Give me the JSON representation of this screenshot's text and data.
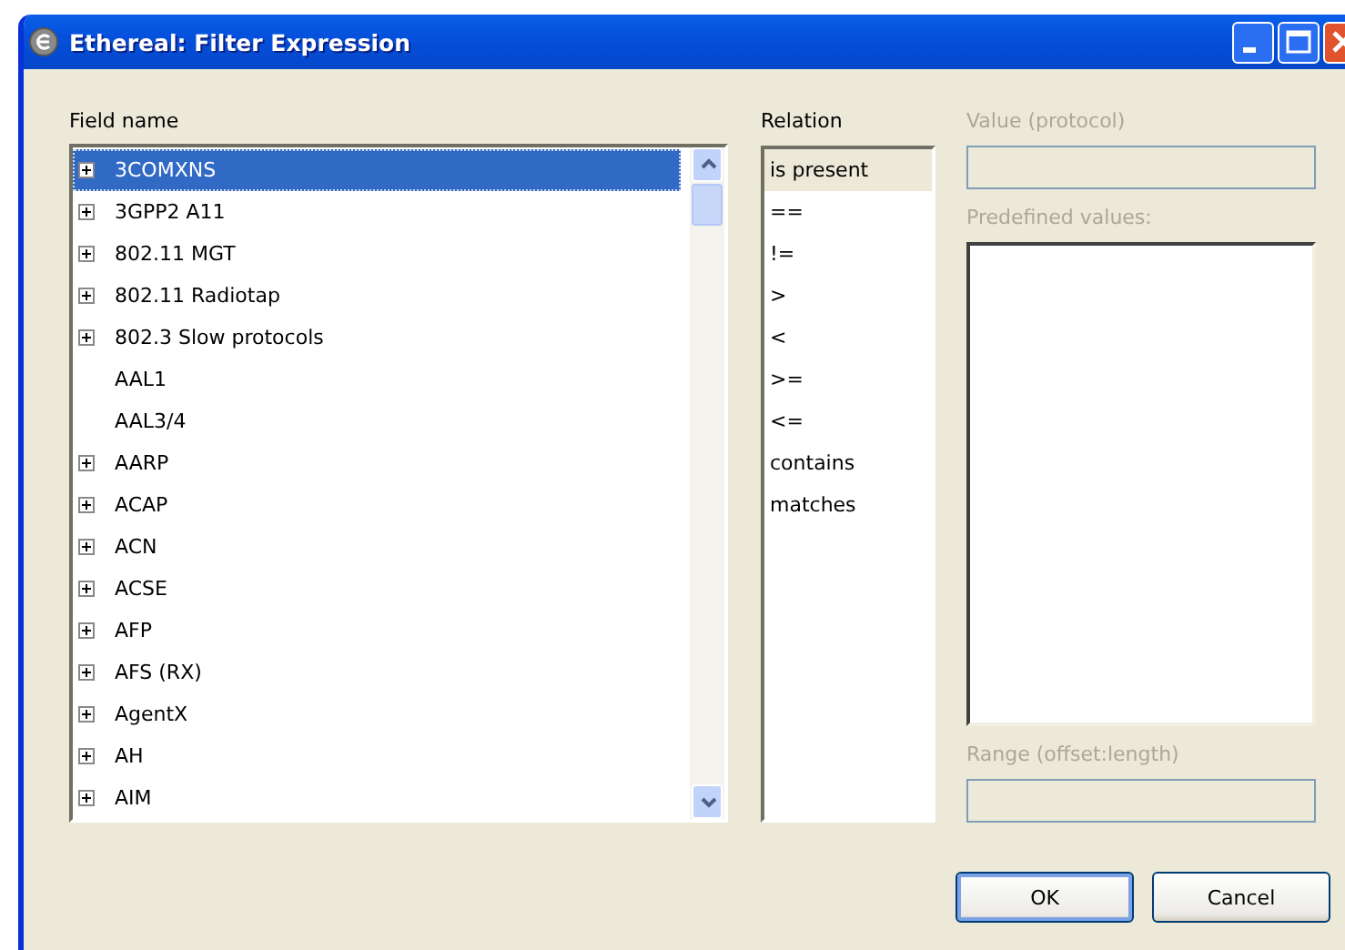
{
  "window": {
    "title": "Ethereal: Filter Expression"
  },
  "field_name": {
    "label": "Field name",
    "items": [
      {
        "label": "3COMXNS",
        "expandable": true,
        "selected": true
      },
      {
        "label": "3GPP2 A11",
        "expandable": true,
        "selected": false
      },
      {
        "label": "802.11 MGT",
        "expandable": true,
        "selected": false
      },
      {
        "label": "802.11 Radiotap",
        "expandable": true,
        "selected": false
      },
      {
        "label": "802.3 Slow protocols",
        "expandable": true,
        "selected": false
      },
      {
        "label": "AAL1",
        "expandable": false,
        "selected": false
      },
      {
        "label": "AAL3/4",
        "expandable": false,
        "selected": false
      },
      {
        "label": "AARP",
        "expandable": true,
        "selected": false
      },
      {
        "label": "ACAP",
        "expandable": true,
        "selected": false
      },
      {
        "label": "ACN",
        "expandable": true,
        "selected": false
      },
      {
        "label": "ACSE",
        "expandable": true,
        "selected": false
      },
      {
        "label": "AFP",
        "expandable": true,
        "selected": false
      },
      {
        "label": "AFS (RX)",
        "expandable": true,
        "selected": false
      },
      {
        "label": "AgentX",
        "expandable": true,
        "selected": false
      },
      {
        "label": "AH",
        "expandable": true,
        "selected": false
      },
      {
        "label": "AIM",
        "expandable": true,
        "selected": false
      }
    ]
  },
  "relation": {
    "label": "Relation",
    "items": [
      {
        "label": "is present",
        "selected": true
      },
      {
        "label": "==",
        "selected": false
      },
      {
        "label": "!=",
        "selected": false
      },
      {
        "label": ">",
        "selected": false
      },
      {
        "label": "<",
        "selected": false
      },
      {
        "label": ">=",
        "selected": false
      },
      {
        "label": "<=",
        "selected": false
      },
      {
        "label": "contains",
        "selected": false
      },
      {
        "label": "matches",
        "selected": false
      }
    ]
  },
  "value": {
    "label": "Value (protocol)",
    "disabled": true
  },
  "predefined_values": {
    "label": "Predefined values:",
    "disabled": true
  },
  "range": {
    "label": "Range (offset:length)",
    "disabled": true
  },
  "buttons": [
    {
      "label": "OK",
      "default": true
    },
    {
      "label": "Cancel",
      "default": false
    }
  ]
}
